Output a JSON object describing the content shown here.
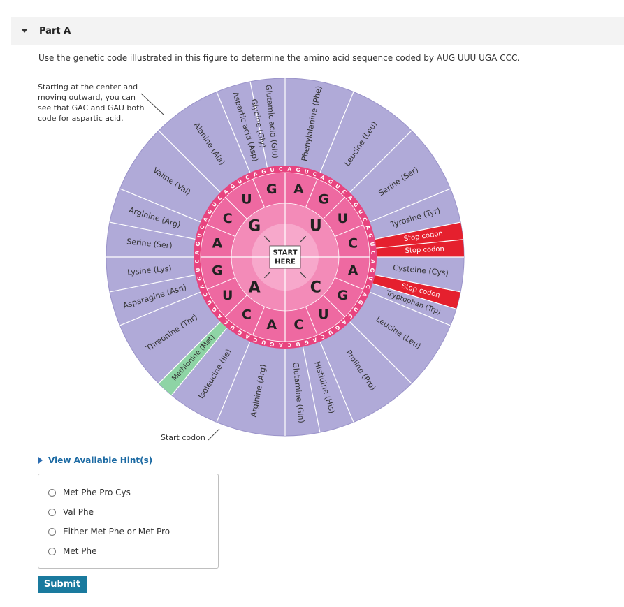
{
  "part": {
    "title": "Part A"
  },
  "question": "Use the genetic code illustrated in this figure to determine the amino acid sequence coded by AUG UUU UGA CCC.",
  "figure": {
    "annotation": "Starting at the center and moving outward, you can see that GAC and GAU both code for aspartic acid.",
    "center_label_1": "START",
    "center_label_2": "HERE",
    "start_codon_label": "Start codon",
    "first_base": [
      "U",
      "C",
      "A",
      "G"
    ],
    "second_base": [
      "A",
      "G",
      "U",
      "C",
      "A",
      "G",
      "U",
      "C",
      "A",
      "C",
      "U",
      "G",
      "A",
      "C",
      "U",
      "G"
    ],
    "third_base": "AGUCAGUCAGUCAGUCAGUCAGUCAGUCAGUCAGUCAGUCAGUCAGUCAGUCAGUCAGUCAGUC",
    "amino_acids": [
      "Phenylalanine (Phe)",
      "Leucine (Leu)",
      "Serine (Ser)",
      "Tyrosine (Tyr)",
      "Stop codon",
      "Stop codon",
      "Cysteine (Cys)",
      "Stop codon",
      "Tryptophan (Trp)",
      "Leucine (Leu)",
      "Proline (Pro)",
      "Histidine (His)",
      "Glutamine (Gln)",
      "Arginine (Arg)",
      "Isoleucine (Ile)",
      "Methionine (Met)",
      "Threonine (Thr)",
      "Asparagine (Asn)",
      "Lysine (Lys)",
      "Serine (Ser)",
      "Arginine (Arg)",
      "Valine (Val)",
      "Alanine (Ala)",
      "Aspartic acid (Asp)",
      "Glutamic acid (Glu)",
      "Glycine (Gly)"
    ],
    "colors": {
      "outer_ring": "#b0aad8",
      "ring_lines": "#ffffff",
      "third_ring": "#e8447f",
      "second_ring": "#ee69a1",
      "first_ring": "#f38bb8",
      "center": "#f7a8cb",
      "stop_codon": "#e5202e",
      "start_codon": "#8ed4a5"
    }
  },
  "hint": {
    "label": "View Available Hint(s)"
  },
  "options": [
    {
      "label": "Met Phe Pro Cys"
    },
    {
      "label": "Val Phe"
    },
    {
      "label": "Either Met Phe or Met Pro"
    },
    {
      "label": "Met Phe"
    }
  ],
  "submit": {
    "label": "Submit"
  }
}
